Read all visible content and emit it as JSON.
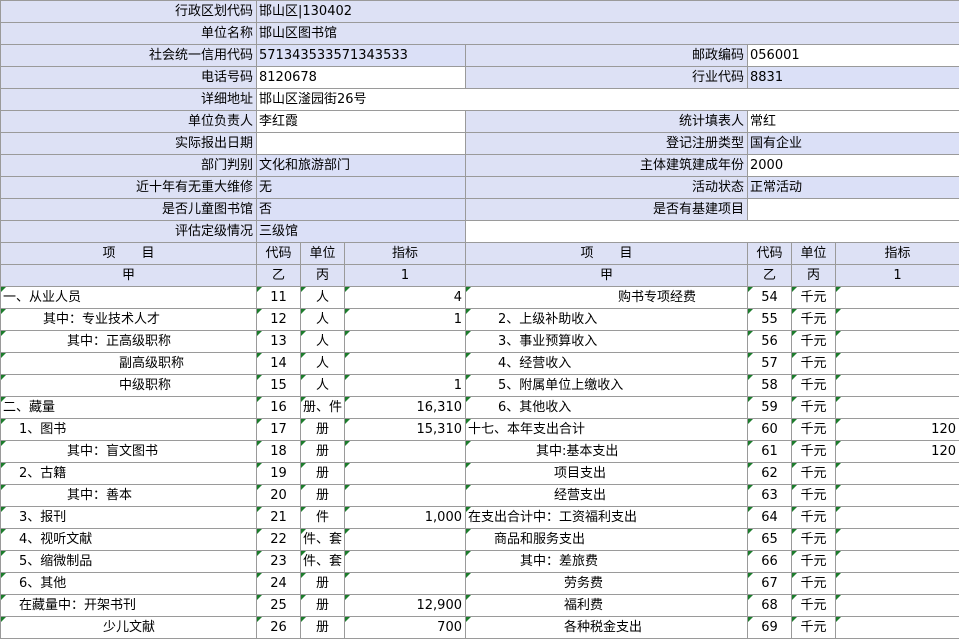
{
  "info": {
    "region_code": {
      "label": "行政区划代码",
      "value": "邯山区|130402"
    },
    "unit_name": {
      "label": "单位名称",
      "value": "邯山区图书馆"
    },
    "credit_code": {
      "label": "社会统一信用代码",
      "value": "571343533571343533"
    },
    "postcode": {
      "label": "邮政编码",
      "value": "056001"
    },
    "phone": {
      "label": "电话号码",
      "value": "8120678"
    },
    "industry_code": {
      "label": "行业代码",
      "value": "8831"
    },
    "address": {
      "label": "详细地址",
      "value": "邯山区滏园街26号"
    },
    "head": {
      "label": "单位负责人",
      "value": "李红霞"
    },
    "filler": {
      "label": "统计填表人",
      "value": "常红"
    },
    "report_date": {
      "label": "实际报出日期",
      "value": ""
    },
    "reg_type": {
      "label": "登记注册类型",
      "value": "国有企业"
    },
    "department": {
      "label": "部门判别",
      "value": "文化和旅游部门"
    },
    "build_year": {
      "label": "主体建筑建成年份",
      "value": "2000"
    },
    "repair": {
      "label": "近十年有无重大维修",
      "value": "无"
    },
    "activity": {
      "label": "活动状态",
      "value": "正常活动"
    },
    "children": {
      "label": "是否儿童图书馆",
      "value": "否"
    },
    "capital": {
      "label": "是否有基建项目",
      "value": ""
    },
    "rating": {
      "label": "评估定级情况",
      "value": "三级馆"
    }
  },
  "table": {
    "header": {
      "item": "项　　目",
      "code": "代码",
      "unit": "单位",
      "indicator": "指标",
      "item_sub": "甲",
      "code_sub": "乙",
      "unit_sub": "丙",
      "indicator_sub": "1"
    },
    "rows": [
      {
        "l_item": "一、从业人员",
        "l_code": "11",
        "l_unit": "人",
        "l_val": "4",
        "r_item": "购书专项经费",
        "r_code": "54",
        "r_unit": "千元",
        "r_val": ""
      },
      {
        "l_item": "其中：专业技术人才",
        "l_code": "12",
        "l_unit": "人",
        "l_val": "1",
        "r_item": "2、上级补助收入",
        "r_code": "55",
        "r_unit": "千元",
        "r_val": ""
      },
      {
        "l_item": "其中：正高级职称",
        "l_code": "13",
        "l_unit": "人",
        "l_val": "",
        "r_item": "3、事业预算收入",
        "r_code": "56",
        "r_unit": "千元",
        "r_val": ""
      },
      {
        "l_item": "副高级职称",
        "l_code": "14",
        "l_unit": "人",
        "l_val": "",
        "r_item": "4、经营收入",
        "r_code": "57",
        "r_unit": "千元",
        "r_val": ""
      },
      {
        "l_item": "中级职称",
        "l_code": "15",
        "l_unit": "人",
        "l_val": "1",
        "r_item": "5、附属单位上缴收入",
        "r_code": "58",
        "r_unit": "千元",
        "r_val": ""
      },
      {
        "l_item": "二、藏量",
        "l_code": "16",
        "l_unit": "册、件",
        "l_val": "16,310",
        "r_item": "6、其他收入",
        "r_code": "59",
        "r_unit": "千元",
        "r_val": ""
      },
      {
        "l_item": "1、图书",
        "l_code": "17",
        "l_unit": "册",
        "l_val": "15,310",
        "r_item": "十七、本年支出合计",
        "r_code": "60",
        "r_unit": "千元",
        "r_val": "120"
      },
      {
        "l_item": "其中：盲文图书",
        "l_code": "18",
        "l_unit": "册",
        "l_val": "",
        "r_item": "其中:基本支出",
        "r_code": "61",
        "r_unit": "千元",
        "r_val": "120"
      },
      {
        "l_item": "2、古籍",
        "l_code": "19",
        "l_unit": "册",
        "l_val": "",
        "r_item": "项目支出",
        "r_code": "62",
        "r_unit": "千元",
        "r_val": ""
      },
      {
        "l_item": "其中：善本",
        "l_code": "20",
        "l_unit": "册",
        "l_val": "",
        "r_item": "经营支出",
        "r_code": "63",
        "r_unit": "千元",
        "r_val": ""
      },
      {
        "l_item": "3、报刊",
        "l_code": "21",
        "l_unit": "件",
        "l_val": "1,000",
        "r_item": "在支出合计中：工资福利支出",
        "r_code": "64",
        "r_unit": "千元",
        "r_val": ""
      },
      {
        "l_item": "4、视听文献",
        "l_code": "22",
        "l_unit": "件、套",
        "l_val": "",
        "r_item": "商品和服务支出",
        "r_code": "65",
        "r_unit": "千元",
        "r_val": ""
      },
      {
        "l_item": "5、缩微制品",
        "l_code": "23",
        "l_unit": "件、套",
        "l_val": "",
        "r_item": "其中：差旅费",
        "r_code": "66",
        "r_unit": "千元",
        "r_val": ""
      },
      {
        "l_item": "6、其他",
        "l_code": "24",
        "l_unit": "册",
        "l_val": "",
        "r_item": "劳务费",
        "r_code": "67",
        "r_unit": "千元",
        "r_val": ""
      },
      {
        "l_item": "在藏量中：开架书刊",
        "l_code": "25",
        "l_unit": "册",
        "l_val": "12,900",
        "r_item": "福利费",
        "r_code": "68",
        "r_unit": "千元",
        "r_val": ""
      },
      {
        "l_item": "少儿文献",
        "l_code": "26",
        "l_unit": "册",
        "l_val": "700",
        "r_item": "各种税金支出",
        "r_code": "69",
        "r_unit": "千元",
        "r_val": ""
      }
    ]
  }
}
